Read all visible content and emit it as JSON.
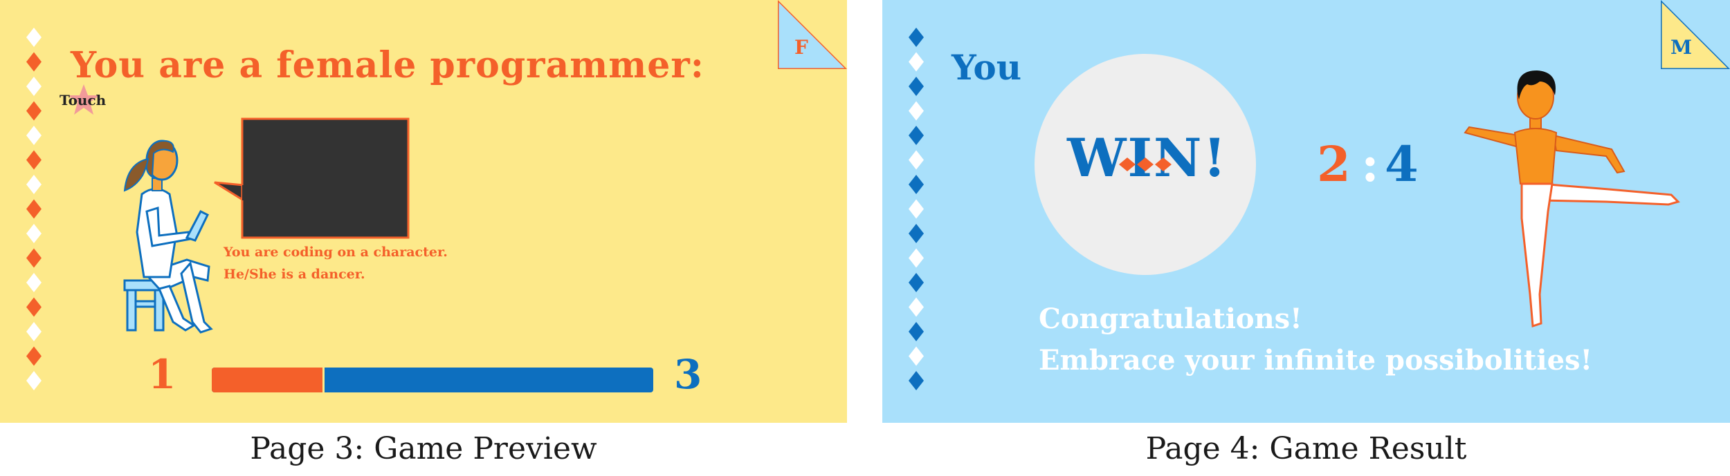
{
  "colors": {
    "yellow_bg": "#fde98a",
    "blue_bg": "#a9e0fb",
    "orange": "#f4602a",
    "blue": "#0d6fbf",
    "screen_dark": "#333333",
    "circle_light": "#eeeeee",
    "white": "#ffffff"
  },
  "page3": {
    "title": "You are a female programmer:",
    "touch_label": "Touch",
    "gender_tag": "F",
    "speech_line1": "You are coding on a character.",
    "speech_line2": "He/She is a dancer.",
    "progress": {
      "left_number": "1",
      "right_number": "3",
      "fill_fraction": 0.25
    },
    "icons": [
      "star-icon",
      "programmer-figure",
      "speech-bubble-screen"
    ],
    "caption": "Page 3: Game Preview"
  },
  "page4": {
    "you_label": "You",
    "result_word": "WIN!",
    "gender_tag": "M",
    "score_left": "2",
    "score_separator": ":",
    "score_right": "4",
    "message_line1": "Congratulations!",
    "message_line2": "Embrace your infinite possibolities!",
    "icons": [
      "dancer-figure",
      "trophy-circle"
    ],
    "caption": "Page 4: Game Result"
  }
}
